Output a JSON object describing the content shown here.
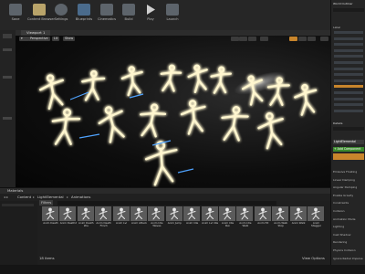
{
  "toolbar": {
    "buttons": [
      {
        "label": "Save",
        "icon": "save-icon"
      },
      {
        "label": "Content Browser",
        "icon": "folder-icon"
      },
      {
        "label": "Settings",
        "icon": "gear-icon"
      },
      {
        "label": "Blueprints",
        "icon": "blueprint-icon"
      },
      {
        "label": "Cinematics",
        "icon": "clapper-icon"
      },
      {
        "label": "Build",
        "icon": "build-icon"
      },
      {
        "label": "Play",
        "icon": "play-icon"
      },
      {
        "label": "Launch",
        "icon": "launch-icon"
      }
    ]
  },
  "viewport": {
    "tab_label": "Viewport 1",
    "perspective_label": "Perspective",
    "lit_label": "Lit",
    "show_label": "Show"
  },
  "right_panel": {
    "outliner_title": "World Outliner",
    "label_header": "Label",
    "details_title": "Details",
    "selected_name": "LightElemental",
    "add_component": "+ Add Component",
    "sections": [
      "Emissive Floating",
      "Linear Damping",
      "Angular Damping",
      "Enable Gravity",
      "Constraints",
      "Collision",
      "Animation Mode",
      "Lighting",
      "Cast Shadow",
      "Rendering",
      "Physics Collision",
      "Ignore Radial Impulse"
    ]
  },
  "content_browser": {
    "title": "Materials",
    "crumbs": [
      "Content",
      "LightElemental",
      "Animations"
    ],
    "filters_label": "Filters",
    "item_count": "18 items",
    "view_options": "View Options",
    "assets": [
      "Anim Death",
      "Anim Death2",
      "Anim Death Idle",
      "Anim Death Flinch",
      "Anim Lvl",
      "Anim Attack",
      "Anim Idle Waves",
      "Anim Jump",
      "Anim Idle",
      "Anim Lvl Idle",
      "Anim Idle Run",
      "Anim Idle Walk",
      "Anim Hit",
      "Anim Walk Stop",
      "Anim Walk",
      "Anim Stagger"
    ]
  },
  "colors": {
    "accent_green": "#3c8a2e",
    "select_orange": "#c8852c",
    "glow": "#fff4c6"
  }
}
